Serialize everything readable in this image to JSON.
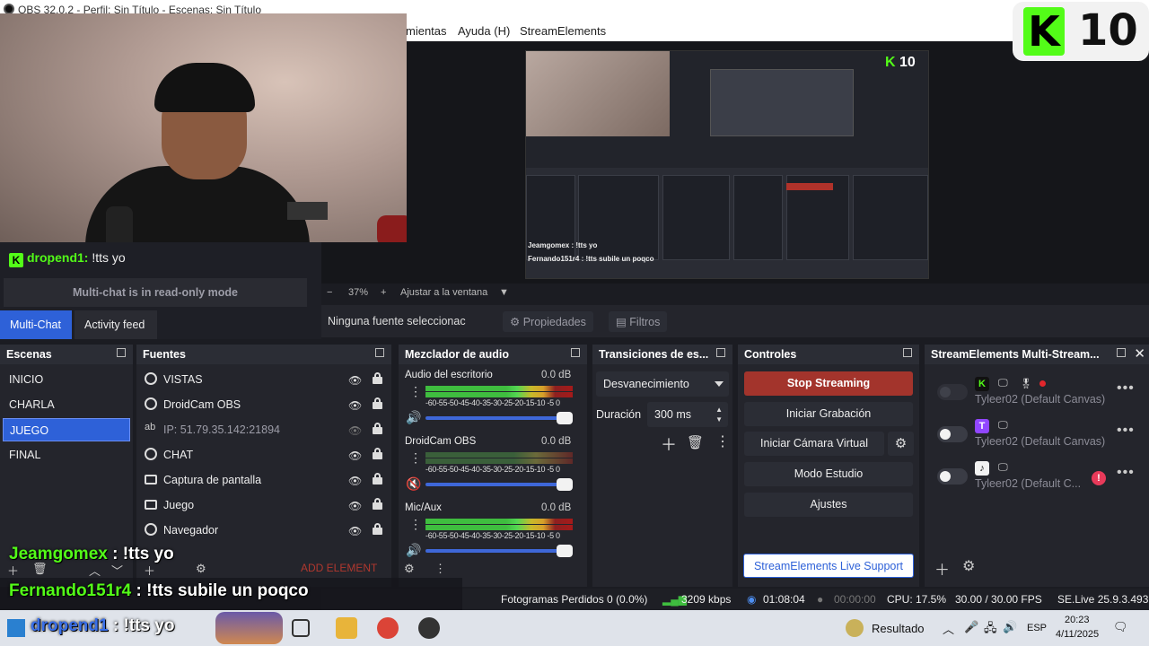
{
  "window": {
    "title": "OBS 32.0.2 - Perfil: Sin Título - Escenas: Sin Título",
    "controls": [
      "—",
      "❐",
      "✕"
    ]
  },
  "menu": {
    "items": [
      "mientas",
      "Ayuda (H)",
      "StreamElements"
    ]
  },
  "kick_badge": {
    "letter": "K",
    "count": "10",
    "accent": "#53fc18"
  },
  "preview": {
    "zoom": "37%",
    "fit_label": "Ajustar a la ventana",
    "mini_chat_1": "Jeamgomex : !tts yo",
    "mini_chat_2": "Fernando151r4 : !tts subile un poqco",
    "mini_kick": "10"
  },
  "source_bar": {
    "no_selection": "Ninguna fuente seleccionac",
    "properties": "Propiedades",
    "filters": "Filtros"
  },
  "chat_panel": {
    "line_user": "dropend1:",
    "line_msg": " !tts yo",
    "read_only": "Multi-chat is in read-only mode",
    "tabs": [
      "Multi-Chat",
      "Activity feed"
    ]
  },
  "scenes": {
    "title": "Escenas",
    "items": [
      "INICIO",
      "CHARLA",
      "JUEGO",
      "FINAL"
    ],
    "selected": "JUEGO"
  },
  "sources": {
    "title": "Fuentes",
    "items": [
      {
        "label": "VISTAS",
        "icon": "globe-icon"
      },
      {
        "label": "DroidCam OBS",
        "icon": "globe-icon"
      },
      {
        "label": "IP: 51.79.35.142:21894",
        "icon": "text-icon"
      },
      {
        "label": "CHAT",
        "icon": "globe-icon"
      },
      {
        "label": "Captura de pantalla",
        "icon": "monitor-icon"
      },
      {
        "label": "Juego",
        "icon": "gamepad-icon"
      },
      {
        "label": "Navegador",
        "icon": "globe-icon"
      }
    ],
    "add_element": "ADD ELEMENT"
  },
  "mixer": {
    "title": "Mezclador de audio",
    "scale": "-60-55-50-45-40-35-30-25-20-15-10 -5  0",
    "channels": [
      {
        "name": "Audio del escritorio",
        "db": "0.0 dB",
        "muted": false
      },
      {
        "name": "DroidCam OBS",
        "db": "0.0 dB",
        "muted": true
      },
      {
        "name": "Mic/Aux",
        "db": "0.0 dB",
        "muted": false
      }
    ]
  },
  "transitions": {
    "title": "Transiciones de es...",
    "selected": "Desvanecimiento",
    "duration_label": "Duración",
    "duration_value": "300 ms"
  },
  "controls": {
    "title": "Controles",
    "stop_streaming": "Stop Streaming",
    "start_recording": "Iniciar Grabación",
    "start_virtual_cam": "Iniciar Cámara Virtual",
    "studio_mode": "Modo Estudio",
    "settings": "Ajustes",
    "live_support": "StreamElements Live Support"
  },
  "multistream": {
    "title": "StreamElements Multi-Stream...",
    "rows": [
      {
        "platform": "kick",
        "account": "Tyleer02 (Default Canvas)",
        "color": "#53fc18",
        "letter": "K"
      },
      {
        "platform": "twitch",
        "account": "Tyleer02 (Default Canvas)",
        "color": "#9146ff",
        "letter": "T"
      },
      {
        "platform": "tiktok",
        "account": "Tyleer02 (Default C...",
        "color": "#111111",
        "letter": "♪"
      }
    ]
  },
  "status_bar": {
    "dropped": "Fotogramas Perdidos 0 (0.0%)",
    "bitrate": "3209 kbps",
    "live_time": "01:08:04",
    "rec_time": "00:00:00",
    "cpu": "CPU: 17.5%",
    "fps": "30.00 / 30.00 FPS",
    "version": "SE.Live 25.9.3.493"
  },
  "overlay_chat": [
    {
      "user": "Jeamgomex",
      "msg": " : !tts yo"
    },
    {
      "user": "Fernando151r4",
      "msg": " : !tts subile un poqco"
    },
    {
      "user": "dropend1",
      "msg": " : !tts yo"
    }
  ],
  "taskbar": {
    "result_label": "Resultado",
    "lang": "ESP",
    "time": "20:23",
    "date": "4/11/2025"
  }
}
